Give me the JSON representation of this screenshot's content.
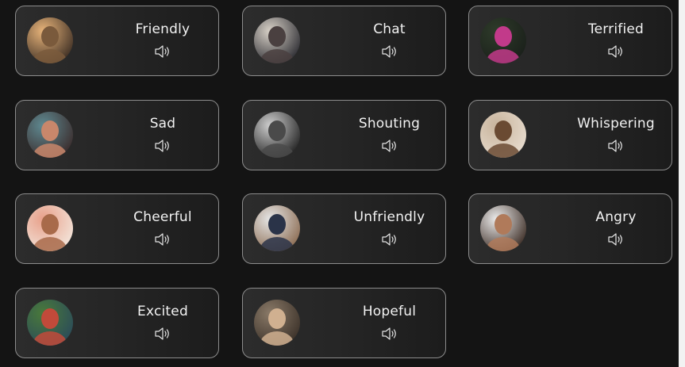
{
  "emotions": [
    {
      "label": "Friendly",
      "icon": "speaker-icon",
      "avatar_colors": [
        "#e8b47a",
        "#7a5a3c",
        "#3a2c22"
      ]
    },
    {
      "label": "Chat",
      "icon": "speaker-icon",
      "avatar_colors": [
        "#d9d2c8",
        "#4a4040",
        "#2a2a30"
      ]
    },
    {
      "label": "Terrified",
      "icon": "speaker-icon",
      "avatar_colors": [
        "#2e3b2a",
        "#c23a8a",
        "#1a1f1a"
      ]
    },
    {
      "label": "Sad",
      "icon": "speaker-icon",
      "avatar_colors": [
        "#5f8a92",
        "#c9876b",
        "#3a2a2a"
      ]
    },
    {
      "label": "Shouting",
      "icon": "speaker-icon",
      "avatar_colors": [
        "#cfcfcf",
        "#4a4a4a",
        "#202020"
      ]
    },
    {
      "label": "Whispering",
      "icon": "speaker-icon",
      "avatar_colors": [
        "#c8b49c",
        "#6a4a32",
        "#e8ddd0"
      ]
    },
    {
      "label": "Cheerful",
      "icon": "speaker-icon",
      "avatar_colors": [
        "#e8a08a",
        "#a86a4a",
        "#f3e6dc"
      ]
    },
    {
      "label": "Unfriendly",
      "icon": "speaker-icon",
      "avatar_colors": [
        "#e6e6e6",
        "#2a3348",
        "#8a6a50"
      ]
    },
    {
      "label": "Angry",
      "icon": "speaker-icon",
      "avatar_colors": [
        "#ececec",
        "#b07a5a",
        "#3a2a22"
      ]
    },
    {
      "label": "Excited",
      "icon": "speaker-icon",
      "avatar_colors": [
        "#4a7a3a",
        "#c24a3a",
        "#2a4a5a"
      ]
    },
    {
      "label": "Hopeful",
      "icon": "speaker-icon",
      "avatar_colors": [
        "#8a7a68",
        "#d0b090",
        "#3a3028"
      ]
    }
  ],
  "colors": {
    "background": "#141414",
    "card_border": "#8c8c8c",
    "text": "#f2f2f2"
  }
}
